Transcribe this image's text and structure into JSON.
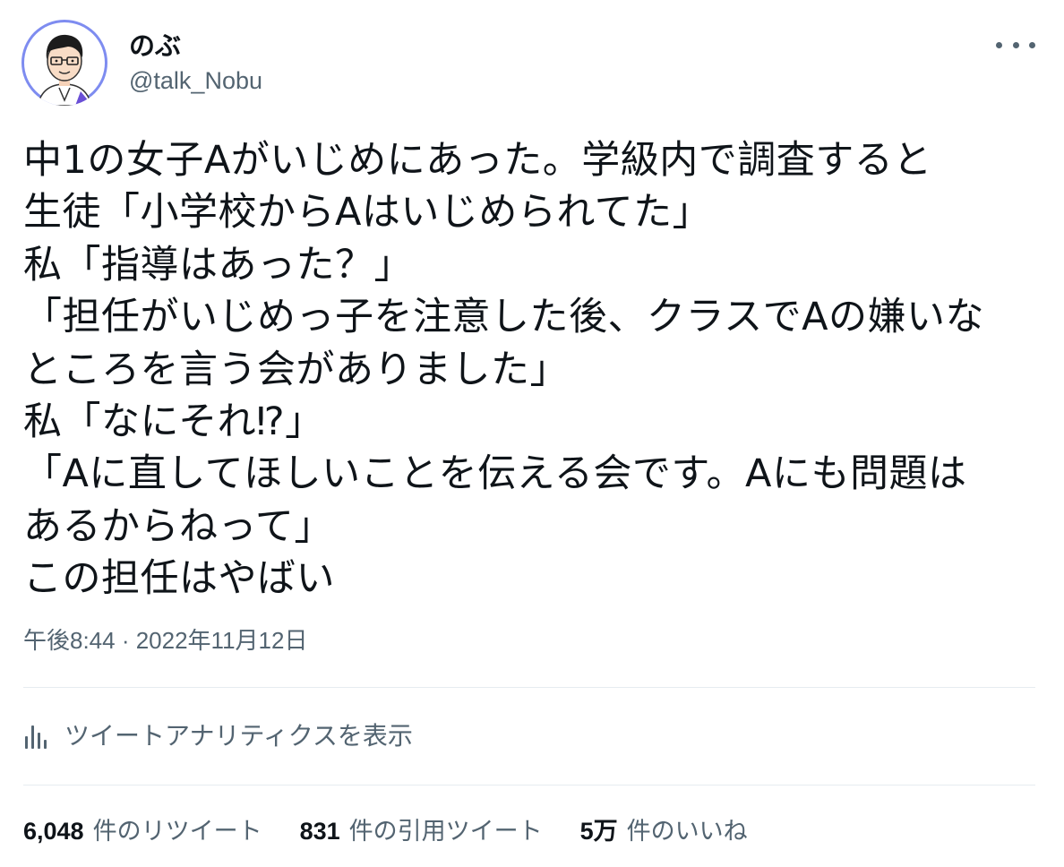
{
  "user": {
    "display_name": "のぶ",
    "handle": "@talk_Nobu",
    "avatar_icon": "avatar-illustration-man-glasses"
  },
  "more_icon": "more-horizontal-icon",
  "tweet_text": "中1の女子Aがいじめにあった。学級内で調査すると\n生徒「小学校からAはいじめられてた」\n私「指導はあった？」\n「担任がいじめっ子を注意した後、クラスでAの嫌いな\nところを言う会がありました」\n私「なにそれ⁉」\n「Aに直してほしいことを伝える会です。Aにも問題は\nあるからねって」\nこの担任はやばい",
  "timestamp": {
    "time": "午後8:44",
    "separator": " · ",
    "date": "2022年11月12日"
  },
  "analytics": {
    "icon": "bar-chart-icon",
    "label": "ツイートアナリティクスを表示"
  },
  "stats": {
    "retweets": {
      "count": "6,048",
      "label": "件のリツイート"
    },
    "quotes": {
      "count": "831",
      "label": "件の引用ツイート"
    },
    "likes": {
      "count": "5万",
      "label": "件のいいね"
    }
  },
  "colors": {
    "text_primary": "#0f1419",
    "text_secondary": "#536471",
    "divider": "#e6ecf0",
    "avatar_ring": "#7e8cf0"
  }
}
